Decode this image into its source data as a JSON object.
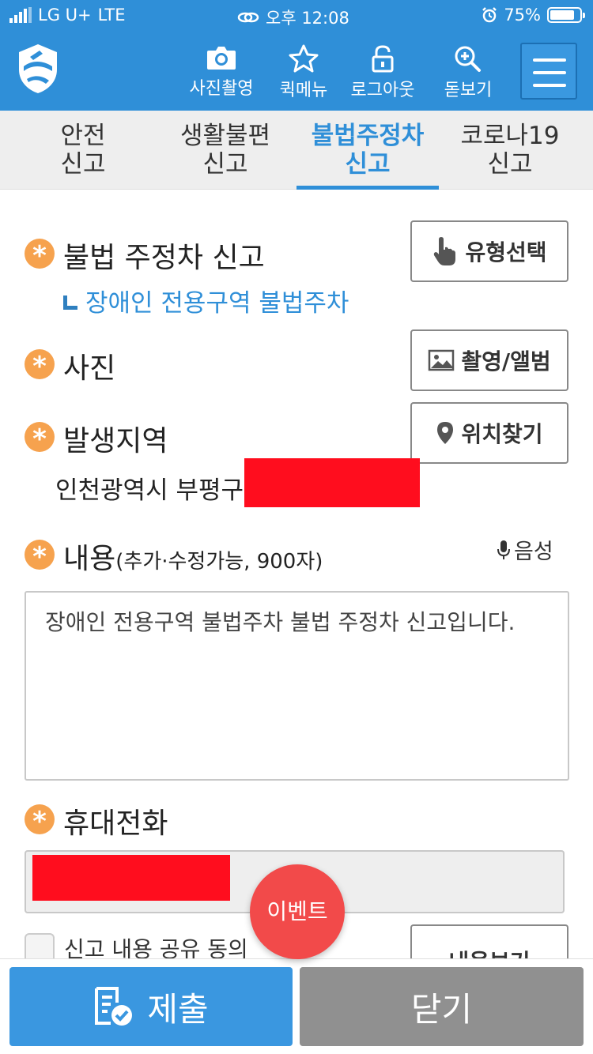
{
  "status_bar": {
    "carrier": "LG U+",
    "network": "LTE",
    "time": "오후 12:08",
    "battery": "75%"
  },
  "header": {
    "tools": [
      {
        "label": "사진촬영",
        "icon": "camera-icon"
      },
      {
        "label": "퀵메뉴",
        "icon": "star-icon"
      },
      {
        "label": "로그아웃",
        "icon": "lock-icon"
      },
      {
        "label": "돋보기",
        "icon": "magnifier-plus-icon"
      }
    ],
    "menu_icon": "hamburger-icon"
  },
  "tabs": [
    {
      "line1": "안전",
      "line2": "신고"
    },
    {
      "line1": "생활불편",
      "line2": "신고"
    },
    {
      "line1": "불법주정차",
      "line2": "신고",
      "active": true
    },
    {
      "line1": "코로나19",
      "line2": "신고"
    }
  ],
  "form": {
    "required_mark": "*",
    "report_type": {
      "label": "불법 주정차 신고",
      "subtype": "장애인 전용구역 불법주차",
      "button": "유형선택"
    },
    "photo": {
      "label": "사진",
      "button": "촬영/앨범"
    },
    "location": {
      "label": "발생지역",
      "address": "인천광역시 부평구",
      "button": "위치찾기"
    },
    "content": {
      "label": "내용",
      "hint": "(추가·수정가능, 900자)",
      "voice_button": "음성",
      "text": "장애인 전용구역 불법주차 불법 주정차 신고입니다."
    },
    "phone": {
      "label": "휴대전화"
    },
    "share_agree": {
      "label": "신고 내용 공유 동의",
      "button": "내용보기"
    },
    "event_button": "이벤트"
  },
  "bottom": {
    "submit": "제출",
    "close": "닫기"
  },
  "colors": {
    "primary": "#2f8fd8",
    "required": "#f6a24e",
    "redaction": "#ff0d1e",
    "close_button": "#909090",
    "event": "#f24a4a"
  }
}
